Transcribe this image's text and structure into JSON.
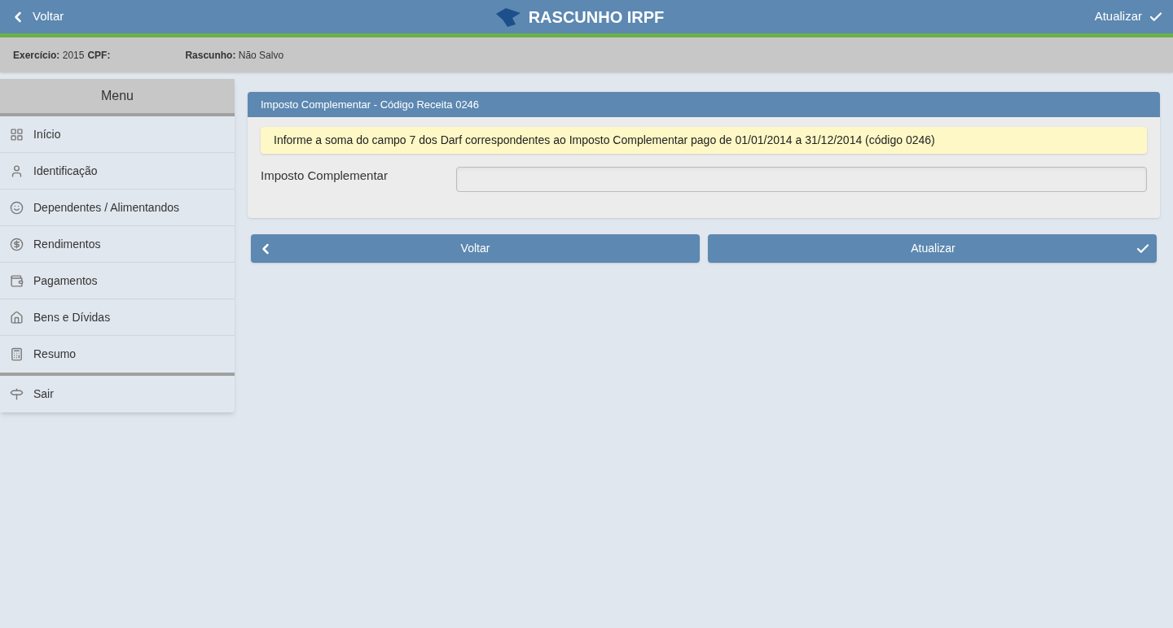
{
  "header": {
    "back": "Voltar",
    "title": "RASCUNHO IRPF",
    "update": "Atualizar"
  },
  "info_bar": [
    {
      "label": "Exercício:",
      "value": "2015"
    },
    {
      "label": "CPF:"
    },
    {
      "label": "Rascunho:",
      "value": "Não Salvo"
    }
  ],
  "menu": {
    "title": "Menu",
    "items": [
      "Início",
      "Identificação",
      "Dependentes / Alimentandos",
      "Rendimentos",
      "Pagamentos",
      "Bens e Dívidas",
      "Resumo"
    ],
    "exit_items": [
      "Sair"
    ]
  },
  "panel": {
    "title": "Imposto Complementar - Código Receita 0246",
    "notice": "Informe a soma do campo 7 dos Darf correspondentes ao Imposto Complementar pago de 01/01/2014 a 31/12/2014 (código 0246)",
    "field_label": "Imposto Complementar"
  },
  "buttons": {
    "back": "Voltar",
    "update": "Atualizar"
  }
}
